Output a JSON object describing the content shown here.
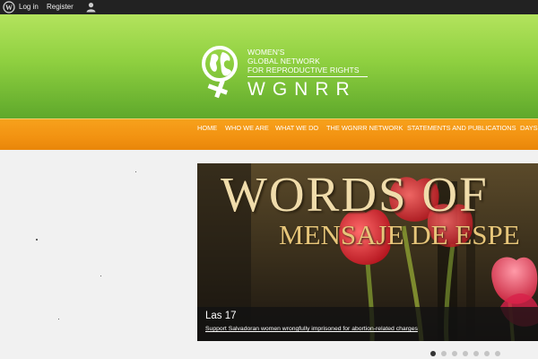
{
  "admin_bar": {
    "login_label": "Log in",
    "register_label": "Register"
  },
  "logo": {
    "line1": "WOMEN'S",
    "line2": "GLOBAL NETWORK",
    "line3": "FOR REPRODUCTIVE RIGHTS",
    "acronym": "WGNRR"
  },
  "nav": {
    "items": [
      {
        "label": "HOME"
      },
      {
        "label": "WHO WE ARE"
      },
      {
        "label": "WHAT WE DO"
      },
      {
        "label": "THE WGNRR NETWORK"
      },
      {
        "label": "STATEMENTS AND PUBLICATIONS"
      },
      {
        "label": "DAYS O"
      }
    ]
  },
  "slider": {
    "image_heading": "WORDS OF",
    "image_subheading": "MENSAJE DE ESPE",
    "caption_title": "Las 17",
    "caption_link": "Support Salvadoran women wrongfully imprisoned for abortion-related charges",
    "active_index": 0,
    "slide_count": 7
  },
  "colors": {
    "admin_bar": "#222222",
    "header_green": "#8fd040",
    "nav_orange": "#f29211",
    "text_white": "#ffffff"
  }
}
